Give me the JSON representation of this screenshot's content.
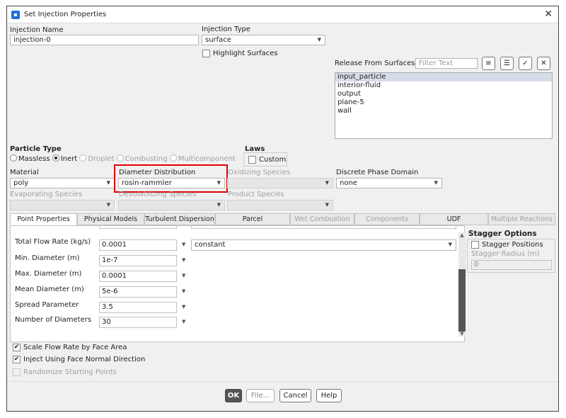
{
  "window": {
    "title": "Set Injection Properties"
  },
  "injection_name": {
    "label": "Injection Name",
    "value": "injection-0"
  },
  "injection_type": {
    "label": "Injection Type",
    "value": "surface"
  },
  "highlight_surfaces": {
    "label": "Highlight Surfaces",
    "checked": false
  },
  "release_from_surfaces": {
    "label": "Release From Surfaces",
    "filter_placeholder": "Filter Text",
    "items": [
      "input_particle",
      "interior-fluid",
      "output",
      "plane-5",
      "wall"
    ],
    "selected": "input_particle"
  },
  "particle_type": {
    "label": "Particle Type",
    "options": [
      "Massless",
      "Inert",
      "Droplet",
      "Combusting",
      "Multicomponent"
    ],
    "selected": "Inert"
  },
  "laws": {
    "label": "Laws",
    "custom_label": "Custom"
  },
  "material": {
    "label": "Material",
    "value": "poly"
  },
  "diameter_distribution": {
    "label": "Diameter Distribution",
    "value": "rosin-rammler"
  },
  "oxidizing_species": {
    "label": "Oxidizing Species",
    "value": ""
  },
  "discrete_phase_domain": {
    "label": "Discrete Phase Domain",
    "value": "none"
  },
  "evaporating_species": {
    "label": "Evaporating Species"
  },
  "devolatilizing_species": {
    "label": "Devolatilizing Species"
  },
  "product_species": {
    "label": "Product Species"
  },
  "tabs": [
    "Point Properties",
    "Physical Models",
    "Turbulent Dispersion",
    "Parcel",
    "Wet Combustion",
    "Components",
    "UDF",
    "Multiple Reactions"
  ],
  "active_tab": "Point Properties",
  "point_properties": {
    "rows": [
      {
        "label": "Total Flow Rate (kg/s)",
        "value": "0.0001"
      },
      {
        "label": "Min. Diameter (m)",
        "value": "1e-7"
      },
      {
        "label": "Max. Diameter (m)",
        "value": "0.0001"
      },
      {
        "label": "Mean Diameter (m)",
        "value": "5e-6"
      },
      {
        "label": "Spread Parameter",
        "value": "3.5"
      },
      {
        "label": "Number of Diameters",
        "value": "30"
      }
    ],
    "flow_rate_profile": "constant"
  },
  "stagger_options": {
    "title": "Stagger Options",
    "positions_label": "Stagger Positions",
    "radius_label": "Stagger Radius (m)",
    "radius_value": "0"
  },
  "options": {
    "scale_flow_rate": "Scale Flow Rate by Face Area",
    "inject_normal": "Inject Using Face Normal Direction",
    "randomize": "Randomize Starting Points"
  },
  "buttons": {
    "ok": "OK",
    "file": "File...",
    "cancel": "Cancel",
    "help": "Help"
  },
  "colors": {
    "highlight": "#e00000",
    "primary_button": "#555555"
  }
}
